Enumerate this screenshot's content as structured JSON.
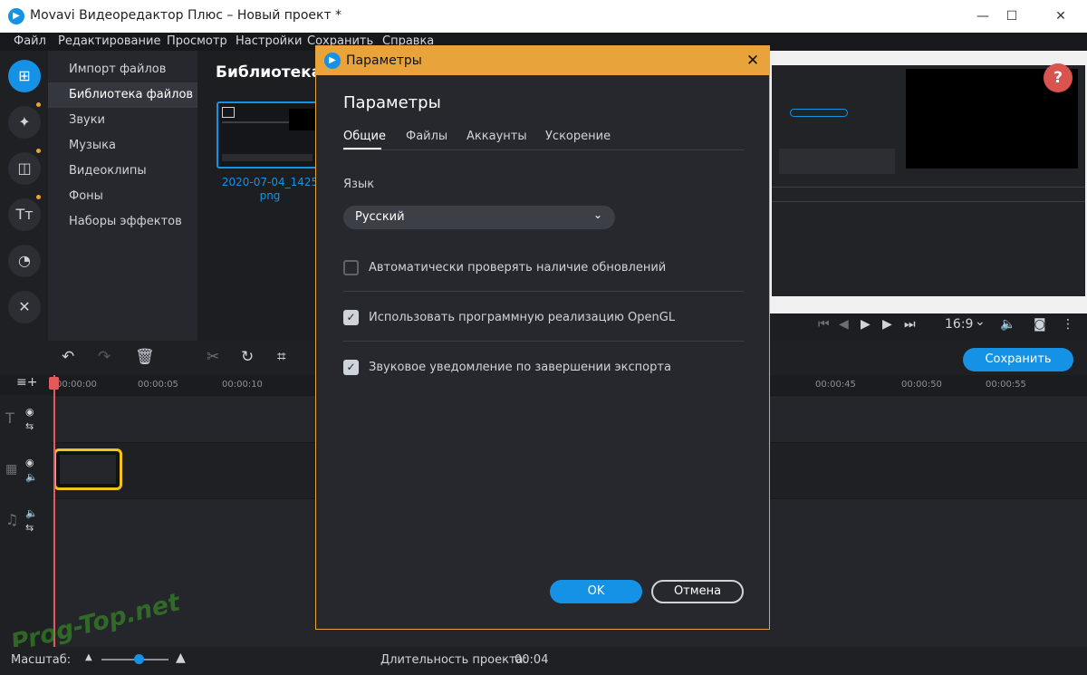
{
  "window": {
    "title": "Movavi Видеоредактор Плюс – Новый проект *",
    "app_icon": "movavi-logo"
  },
  "menu": [
    {
      "label": "Файл"
    },
    {
      "label": "Редактирование"
    },
    {
      "label": "Просмотр"
    },
    {
      "label": "Настройки"
    },
    {
      "label": "Сохранить"
    },
    {
      "label": "Справка"
    }
  ],
  "sidebar": {
    "tools": [
      {
        "icon": "import-icon",
        "active": true
      },
      {
        "icon": "magic-wand-icon",
        "dot": true
      },
      {
        "icon": "transitions-icon",
        "dot": true
      },
      {
        "icon": "titles-icon",
        "dot": true
      },
      {
        "icon": "stickers-icon"
      },
      {
        "icon": "tools-icon"
      }
    ],
    "categories": [
      {
        "label": "Импорт файлов"
      },
      {
        "label": "Библиотека файлов",
        "active": true
      },
      {
        "label": "Звуки"
      },
      {
        "label": "Музыка"
      },
      {
        "label": "Видеоклипы"
      },
      {
        "label": "Фоны"
      },
      {
        "label": "Наборы эффектов"
      }
    ]
  },
  "library": {
    "title": "Библиотека",
    "file_name_line1": "2020-07-04_1425",
    "file_name_line2": "png"
  },
  "player": {
    "help": "?",
    "aspect": "16:9",
    "aspect_chevron": "⌄"
  },
  "timeline": {
    "save_label": "Сохранить",
    "ruler_labels": [
      "00:00:00",
      "00:00:05",
      "00:00:10",
      "00:00:45",
      "00:00:50",
      "00:00:55"
    ]
  },
  "status": {
    "scale_label": "Масштаб:",
    "duration_label": "Длительность проекта:",
    "duration_value": "00:04",
    "zoom_level": 0.55
  },
  "watermark": "Prog-Top.net",
  "dialog": {
    "title": "Параметры",
    "heading": "Параметры",
    "tabs": [
      {
        "label": "Общие",
        "active": true
      },
      {
        "label": "Файлы"
      },
      {
        "label": "Аккаунты"
      },
      {
        "label": "Ускорение"
      }
    ],
    "language_label": "Язык",
    "language_value": "Русский",
    "checkboxes": [
      {
        "label": "Автоматически проверять наличие обновлений",
        "checked": false
      },
      {
        "label": "Использовать программную реализацию OpenGL",
        "checked": true
      },
      {
        "label": "Звуковое уведомление по завершении экспорта",
        "checked": true
      }
    ],
    "ok_label": "OK",
    "cancel_label": "Отмена"
  },
  "colors": {
    "accent": "#1592e6",
    "dialog_border": "#e8a33b",
    "clip_border": "#f2c31c",
    "playhead": "#e45a5a"
  }
}
